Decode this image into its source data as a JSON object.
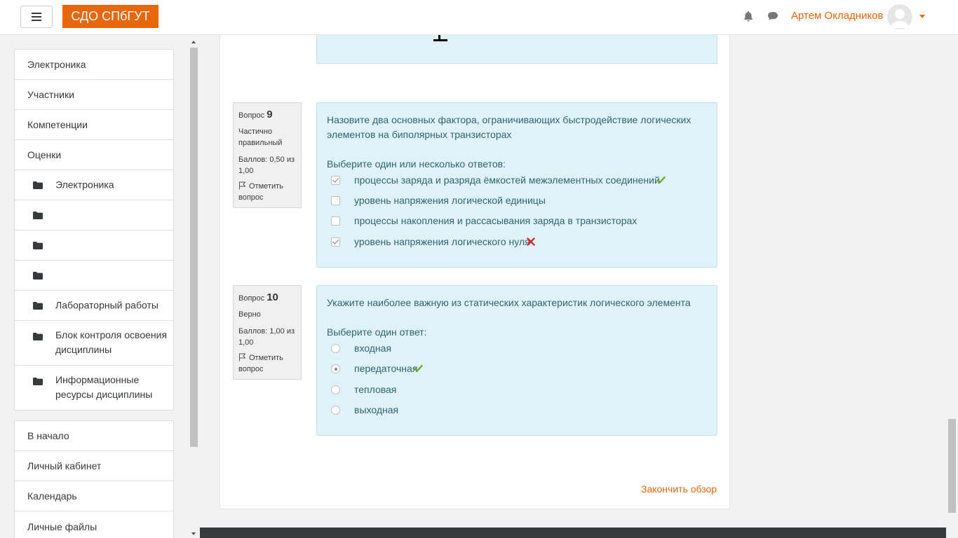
{
  "header": {
    "brand": "СДО СПбГУТ",
    "user_name": "Артем Окладников"
  },
  "sidebar": {
    "course_items": [
      {
        "label": "Электроника"
      },
      {
        "label": "Участники"
      },
      {
        "label": "Компетенции"
      },
      {
        "label": "Оценки"
      },
      {
        "label": "Электроника"
      },
      {
        "label": ""
      },
      {
        "label": ""
      },
      {
        "label": ""
      },
      {
        "label": "Лабораторный работы"
      },
      {
        "label": "Блок контроля освоения дисциплины"
      },
      {
        "label": "Информационные ресурсы дисциплины"
      }
    ],
    "site_items": [
      {
        "label": "В начало"
      },
      {
        "label": "Личный кабинет"
      },
      {
        "label": "Календарь"
      },
      {
        "label": "Личные файлы"
      }
    ]
  },
  "questions": [
    {
      "prefix": "Вопрос",
      "number": "9",
      "state": "Частично правильный",
      "grade": "Баллов: 0,50 из 1,00",
      "flag": "Отметить вопрос",
      "text": "Назовите два основных фактора, ограничивающих быстродействие логических элементов на биполярных транзисторах",
      "prompt": "Выберите один или несколько ответов:",
      "options": [
        {
          "label": "процессы заряда и разряда ёмкостей межэлементных соединений",
          "checked": true,
          "mark": "correct"
        },
        {
          "label": "уровень напряжения логической единицы",
          "checked": false,
          "mark": ""
        },
        {
          "label": "процессы накопления и рассасывания заряда в транзисторах",
          "checked": false,
          "mark": ""
        },
        {
          "label": "уровень напряжения логического нуля",
          "checked": true,
          "mark": "incorrect"
        }
      ]
    },
    {
      "prefix": "Вопрос",
      "number": "10",
      "state": "Верно",
      "grade": "Баллов: 1,00 из 1,00",
      "flag": "Отметить вопрос",
      "text": "Укажите наиболее важную из статических характеристик логического элемента",
      "prompt": "Выберите один ответ:",
      "options": [
        {
          "label": "входная",
          "checked": false,
          "mark": ""
        },
        {
          "label": "передаточная",
          "checked": true,
          "mark": "correct"
        },
        {
          "label": "тепловая",
          "checked": false,
          "mark": ""
        },
        {
          "label": "выходная",
          "checked": false,
          "mark": ""
        }
      ]
    }
  ],
  "finish_review": "Закончить обзор",
  "colors": {
    "brand": "#e8660c",
    "question_bg": "#def2f8",
    "question_text": "#2f6473",
    "correct": "#6cab29",
    "incorrect": "#d9262c"
  },
  "icons": [
    "hamburger-icon",
    "bell-icon",
    "chat-icon",
    "avatar-icon",
    "folder-icon",
    "flag-icon",
    "check-icon",
    "cross-icon"
  ]
}
